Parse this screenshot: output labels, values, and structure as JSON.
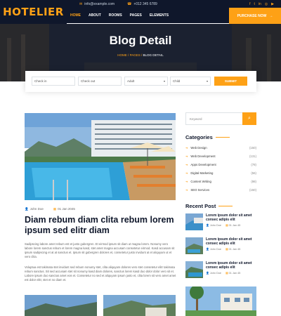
{
  "brand": {
    "logo": "HOTELIER"
  },
  "topbar": {
    "email": "info@example.com",
    "phone": "+012 345 6789",
    "social_icons": [
      "facebook-icon",
      "twitter-icon",
      "linkedin-icon",
      "instagram-icon",
      "youtube-icon"
    ]
  },
  "nav": {
    "items": [
      "HOME",
      "ABOUT",
      "ROOMS",
      "PAGES",
      "ELEMENTS"
    ],
    "cta": "PURCHASE NOW"
  },
  "hero": {
    "title": "Blog Detail",
    "breadcrumb": [
      "HOME",
      "PAGES",
      "BLOG DETAIL"
    ]
  },
  "booking": {
    "checkin": "Check in",
    "checkout": "Check out",
    "adult": "Adult",
    "child": "Child",
    "search": "SUBMIT"
  },
  "post": {
    "author": "John Doe",
    "date": "01 Jan 2045",
    "title": "Diam rebum diam clita rebum lorem ipsum sed elitr diam",
    "p1": "Sadipscing labore amet rebum est et justo gubergren. Et eirmod ipsum sit diam ut magna lorem. Nonumy vero labore lorem sanctus rebum et lorem magna kasd, stet amet magna accusam consetetur eirmod. Kasd accusam sit ipsum sadipscing et at at sanctus et. Ipsum sit gubergren dolores et, consetetur justo invidunt at et aliquyam ut et vero clita.",
    "p2": "Voluptua est takimata stet invidunt sed rebum nonumy stet, clita aliquyam dolores vero stet consetetur elitr takimata rebum sanctus. Sit sed accusam stet sit nonumy kasd diam dolores, sanctus lorem kasd duo dolor dolor vero sit et. Labore ipsum duo sanctus amet eos et. Consetetur no sed et aliquyam ipsum justo et, clita lorem sit vero amet amet est dolor elitr, stet et no diam et."
  },
  "sidebar": {
    "keyword_placeholder": "Keyword",
    "categories_title": "Categories",
    "categories": [
      {
        "name": "Web Design",
        "count": "(150)"
      },
      {
        "name": "Web Development",
        "count": "(131)"
      },
      {
        "name": "Apps Development",
        "count": "(78)"
      },
      {
        "name": "Digital Marketing",
        "count": "(56)"
      },
      {
        "name": "Content Writing",
        "count": "(98)"
      },
      {
        "name": "SEO Services",
        "count": "(150)"
      }
    ],
    "recent_title": "Recent Post",
    "recent": [
      {
        "title": "Lorem ipsum dolor sit amet consec adipis elit",
        "author": "John Doe",
        "date": "01 Jan 45"
      },
      {
        "title": "Lorem ipsum dolor sit amet consec adipis elit",
        "author": "John Doe",
        "date": "01 Jan 45"
      },
      {
        "title": "Lorem ipsum dolor sit amet consec adipis elit",
        "author": "John Doe",
        "date": "01 Jan 45"
      }
    ]
  },
  "colors": {
    "primary": "#fea116",
    "dark": "#0f172b"
  }
}
